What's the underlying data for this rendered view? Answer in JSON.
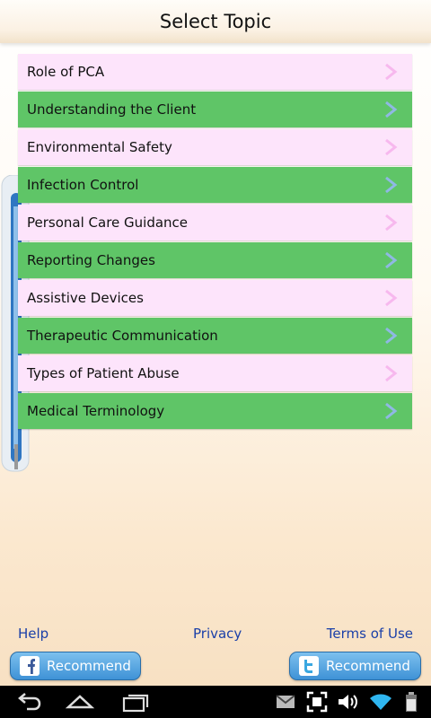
{
  "header": {
    "title": "Select Topic"
  },
  "topics": [
    {
      "label": "Role of PCA"
    },
    {
      "label": "Understanding the Client"
    },
    {
      "label": "Environmental Safety"
    },
    {
      "label": "Infection Control"
    },
    {
      "label": "Personal Care Guidance"
    },
    {
      "label": "Reporting Changes"
    },
    {
      "label": "Assistive Devices"
    },
    {
      "label": "Therapeutic Communication"
    },
    {
      "label": "Types of Patient Abuse"
    },
    {
      "label": "Medical Terminology"
    }
  ],
  "footer": {
    "help": "Help",
    "privacy": "Privacy",
    "terms": "Terms of Use"
  },
  "share": {
    "facebook_label": "Recommend",
    "twitter_label": "Recommend"
  },
  "colors": {
    "pink_row": "#fde4fb",
    "green_row": "#5fc567",
    "link": "#1a3fa8",
    "button": "#3f92d6"
  },
  "icons": [
    "chevron-right-icon",
    "facebook-icon",
    "twitter-icon",
    "back-icon",
    "home-icon",
    "recent-apps-icon",
    "gmail-icon",
    "screenshot-icon",
    "volume-icon",
    "wifi-icon",
    "battery-icon"
  ]
}
